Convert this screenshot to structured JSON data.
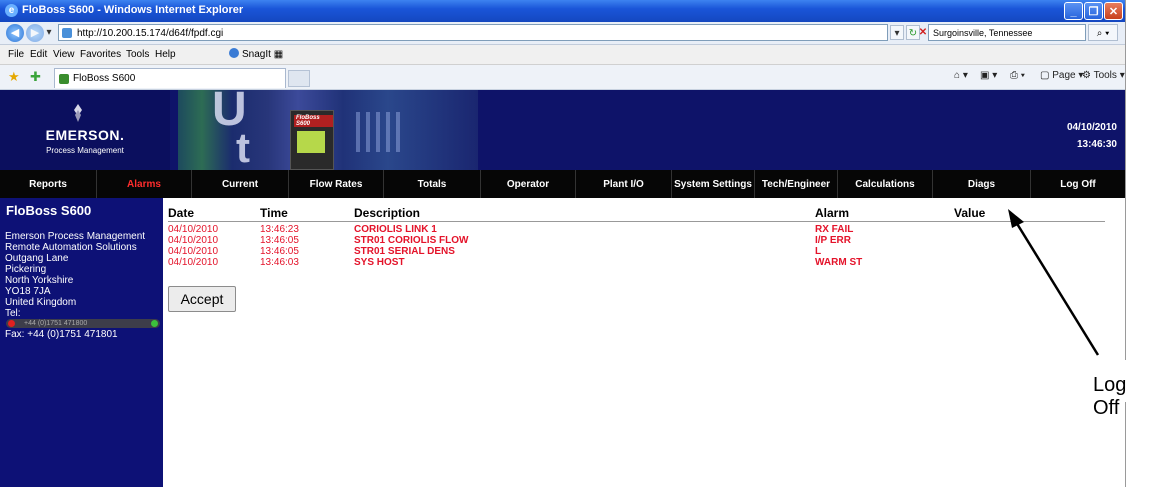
{
  "window": {
    "title": "FloBoss S600 - Windows Internet Explorer"
  },
  "address": {
    "url": "http://10.200.15.174/d64f/fpdf.cgi",
    "search_value": "Surgoinsville, Tennessee"
  },
  "menu": {
    "file": "File",
    "edit": "Edit",
    "view": "View",
    "favorites": "Favorites",
    "tools": "Tools",
    "help": "Help",
    "snagit": "SnagIt"
  },
  "tab": {
    "label": "FloBoss S600"
  },
  "commandbar": {
    "page": "Page",
    "tools": "Tools"
  },
  "header": {
    "brand": "EMERSON.",
    "brand_sub": "Process Management",
    "device_label": "FloBoss S600",
    "date": "04/10/2010",
    "time": "13:46:30"
  },
  "nav": {
    "items": [
      {
        "label": "Reports",
        "active": false
      },
      {
        "label": "Alarms",
        "active": true
      },
      {
        "label": "Current",
        "active": false
      },
      {
        "label": "Flow Rates",
        "active": false
      },
      {
        "label": "Totals",
        "active": false
      },
      {
        "label": "Operator",
        "active": false
      },
      {
        "label": "Plant I/O",
        "active": false
      },
      {
        "label": "System Settings",
        "active": false
      },
      {
        "label": "Tech/Engineer",
        "active": false
      },
      {
        "label": "Calculations",
        "active": false
      },
      {
        "label": "Diags",
        "active": false
      },
      {
        "label": "Log Off",
        "active": false
      }
    ]
  },
  "sidebar": {
    "title": "FloBoss S600",
    "lines": [
      "Emerson Process Management",
      "Remote Automation Solutions",
      "Outgang Lane",
      "Pickering",
      "North Yorkshire",
      "YO18 7JA",
      "United Kingdom",
      "Tel:"
    ],
    "phone": "+44 (0)1751 471800",
    "fax": "Fax: +44 (0)1751 471801"
  },
  "alarms": {
    "columns": {
      "date": "Date",
      "time": "Time",
      "description": "Description",
      "alarm": "Alarm",
      "value": "Value"
    },
    "rows": [
      {
        "date": "04/10/2010",
        "time": "13:46:23",
        "description": "CORIOLIS LINK 1",
        "alarm": "RX FAIL",
        "value": ""
      },
      {
        "date": "04/10/2010",
        "time": "13:46:05",
        "description": "STR01 CORIOLIS FLOW",
        "alarm": "I/P ERR",
        "value": ""
      },
      {
        "date": "04/10/2010",
        "time": "13:46:05",
        "description": "STR01 SERIAL DENS",
        "alarm": "L",
        "value": ""
      },
      {
        "date": "04/10/2010",
        "time": "13:46:03",
        "description": "SYS HOST",
        "alarm": "WARM ST",
        "value": ""
      }
    ],
    "accept_label": "Accept"
  },
  "annotation": {
    "label": "Log Off"
  },
  "colors": {
    "alarm_text": "#e4132a",
    "active_nav": "#ff2d2d",
    "banner": "#0e1369",
    "sidebar": "#0d1176",
    "nav": "#060606"
  }
}
